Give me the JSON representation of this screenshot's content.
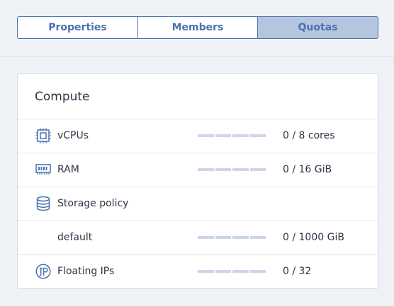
{
  "tabs": [
    {
      "label": "Properties",
      "active": false
    },
    {
      "label": "Members",
      "active": false
    },
    {
      "label": "Quotas",
      "active": true
    }
  ],
  "card": {
    "title": "Compute",
    "rows": [
      {
        "icon": "cpu-icon",
        "label": "vCPUs",
        "has_bar": true,
        "used_fraction": 0,
        "value": "0 / 8 cores"
      },
      {
        "icon": "ram-icon",
        "label": "RAM",
        "has_bar": true,
        "used_fraction": 0,
        "value": "0 / 16 GiB"
      },
      {
        "icon": "database-icon",
        "label": "Storage policy",
        "has_bar": false,
        "value": ""
      },
      {
        "icon": "",
        "label": "default",
        "has_bar": true,
        "used_fraction": 0,
        "value": "0 / 1000 GiB"
      },
      {
        "icon": "floating-ip-icon",
        "label": "Floating IPs",
        "has_bar": true,
        "used_fraction": 0,
        "value": "0 / 32"
      }
    ]
  },
  "colors": {
    "accent": "#4a72b0",
    "tab_active_bg": "#b6c5de",
    "bar_empty": "#cdd5e6",
    "page_bg": "#eef1f6"
  }
}
